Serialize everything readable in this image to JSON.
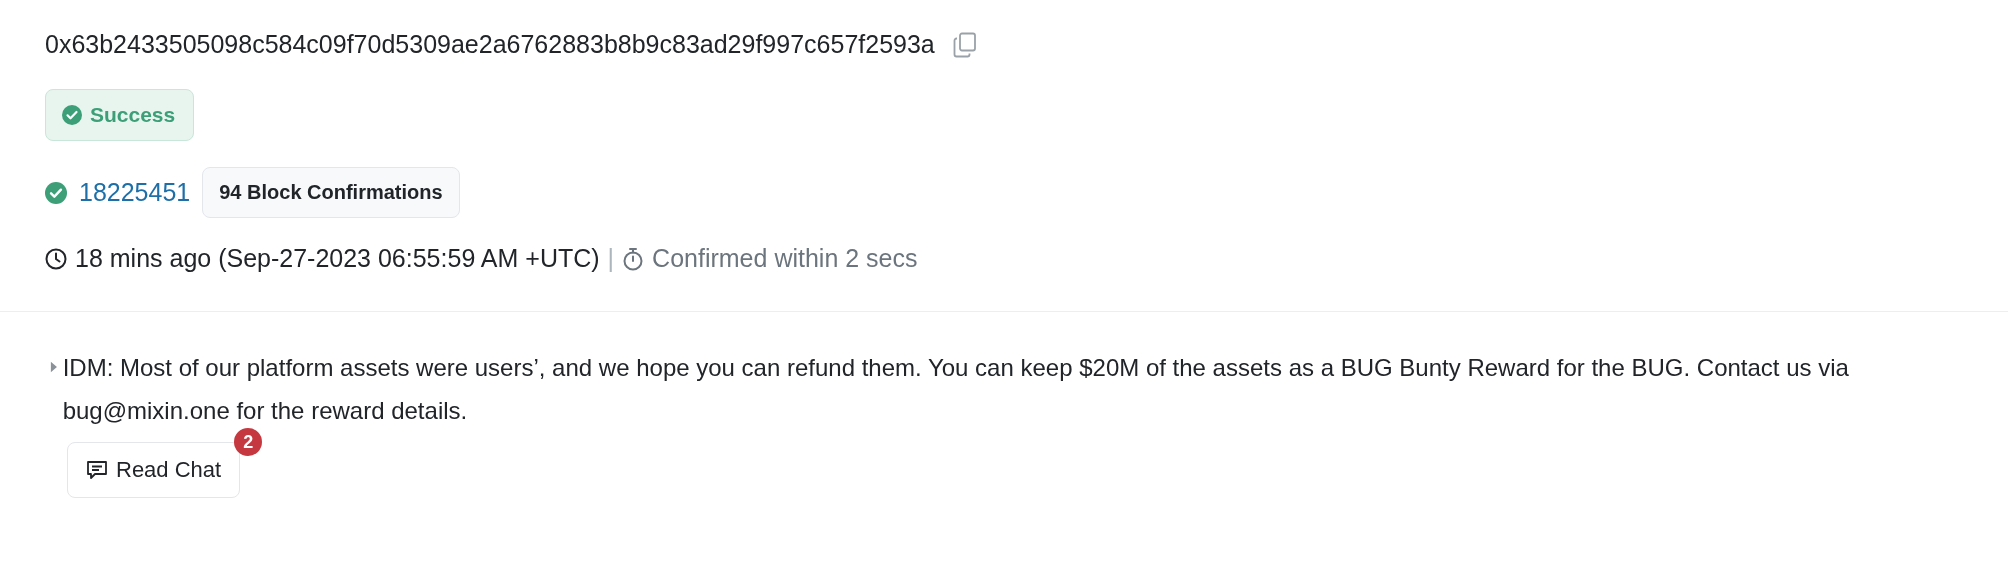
{
  "transaction_hash": "0x63b2433505098c584c09f70d5309ae2a6762883b8b9c83ad29f997c657f2593a",
  "status": {
    "label": "Success",
    "kind": "success"
  },
  "block": {
    "number": "18225451",
    "confirmations": "94 Block Confirmations"
  },
  "timestamp": {
    "time": "18 mins ago (Sep-27-2023 06:55:59 AM +UTC)",
    "separator": "|",
    "confirmed": "Confirmed within 2 secs"
  },
  "input_message": {
    "text": "IDM: Most of our platform assets were users’, and we hope you can refund them. You can keep $20M of the assets as a BUG Bunty Reward for the BUG. Contact us via bug@mixin.one for the reward details.",
    "expanded": false
  },
  "read_chat": {
    "label": "Read Chat",
    "badge": "2"
  }
}
